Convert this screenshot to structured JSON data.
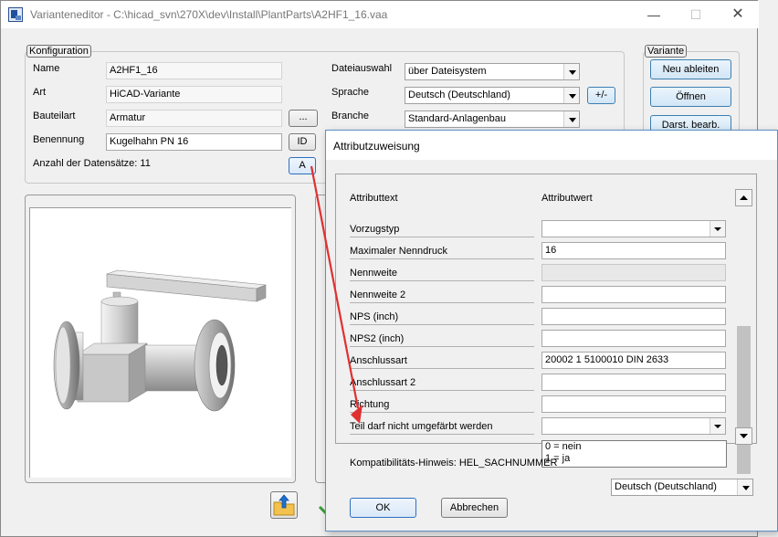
{
  "window": {
    "title": "Varianteneditor - C:\\hicad_svn\\270X\\dev\\Install\\PlantParts\\A2HF1_16.vaa",
    "min": "—",
    "max": "☐",
    "close": "✕"
  },
  "konfiguration": {
    "legend": "Konfiguration",
    "name_label": "Name",
    "name_value": "A2HF1_16",
    "art_label": "Art",
    "art_value": "HiCAD-Variante",
    "bauteilart_label": "Bauteilart",
    "bauteilart_value": "Armatur",
    "bauteilart_button": "...",
    "benennung_label": "Benennung",
    "benennung_value": "Kugelhahn PN 16",
    "id_button": "ID",
    "anzahl_label": "Anzahl der Datensätze: 11",
    "a_button": "A",
    "dateiauswahl_label": "Dateiauswahl",
    "dateiauswahl_value": "über Dateisystem",
    "sprache_label": "Sprache",
    "sprache_value": "Deutsch (Deutschland)",
    "plusminus_button": "+/-",
    "branche_label": "Branche",
    "branche_value": "Standard-Anlagenbau"
  },
  "variante": {
    "legend": "Variante",
    "neu_ableiten": "Neu ableiten",
    "oeffnen": "Öffnen",
    "darst_bearb": "Darst. bearb."
  },
  "dialog": {
    "title": "Attributzuweisung",
    "col_attributtext": "Attributtext",
    "col_attributwert": "Attributwert",
    "rows": [
      {
        "label": "Vorzugstyp",
        "value": "",
        "kind": "combo"
      },
      {
        "label": "Maximaler Nenndruck",
        "value": "16",
        "kind": "edit"
      },
      {
        "label": "Nennweite",
        "value": "",
        "kind": "disabled"
      },
      {
        "label": "Nennweite 2",
        "value": "",
        "kind": "edit"
      },
      {
        "label": "NPS (inch)",
        "value": "",
        "kind": "edit"
      },
      {
        "label": "NPS2 (inch)",
        "value": "",
        "kind": "edit"
      },
      {
        "label": "Anschlussart",
        "value": "20002 1 5100010 DIN 2633",
        "kind": "edit"
      },
      {
        "label": "Anschlussart 2",
        "value": "",
        "kind": "edit"
      },
      {
        "label": "Richtung",
        "value": "",
        "kind": "edit"
      },
      {
        "label": "Teil darf nicht umgefärbt werden",
        "value": "",
        "kind": "combo"
      }
    ],
    "dropdown_options": [
      "0 = nein",
      "1 = ja"
    ],
    "hint_label": "Kompatibilitäts-Hinweis: HEL_SACHNUMMER",
    "language_value": "Deutsch (Deutschland)",
    "ok": "OK",
    "abbrechen": "Abbrechen"
  },
  "colors": {
    "annotation_arrow": "#e03030",
    "focus_border": "#2f6fc0"
  }
}
